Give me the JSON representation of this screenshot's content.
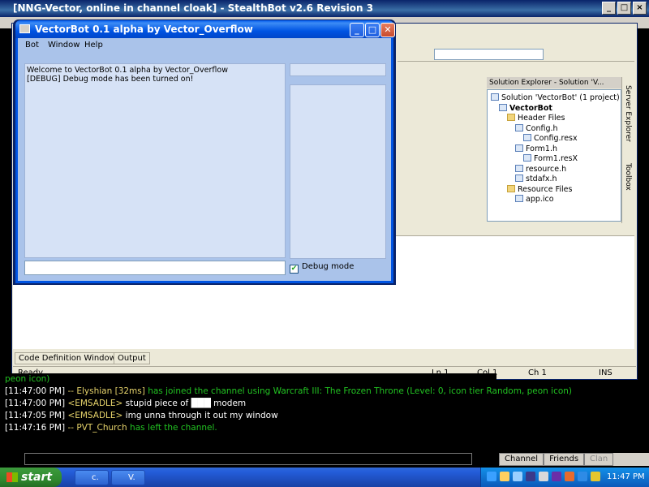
{
  "stealthbot": {
    "title": "[NNG-Vector, online in channel cloak] - StealthBot v2.6 Revision 3",
    "chat": [
      {
        "time": "[11:47:00 PM]",
        "prefix": "-- ",
        "user": "Elyshian [32ms]",
        "text": " has joined the channel using Warcraft III: The Frozen Throne (Level: 0, icon tier Random, peon icon)"
      },
      {
        "time": "[11:47:00 PM]",
        "user": "<EMSADLE>",
        "text": " stupid piece of ███ modem"
      },
      {
        "time": "[11:47:05 PM]",
        "user": "<EMSADLE>",
        "text": " img unna through it out my window"
      },
      {
        "time": "[11:47:16 PM]",
        "prefix": "-- ",
        "user": "PVT_Church",
        "text": " has left the channel."
      }
    ],
    "chat_top_snippet": "peon icon)",
    "tabs": [
      "Channel",
      "Friends",
      "Clan"
    ]
  },
  "vectorbot": {
    "title": "VectorBot 0.1 alpha by Vector_Overflow",
    "menu": [
      "Bot",
      "Window",
      "Help"
    ],
    "log": [
      "Welcome to VectorBot 0.1 alpha by Vector_Overflow",
      "[DEBUG] Debug mode has been turned on!"
    ],
    "debug_label": "Debug mode",
    "debug_checked": true
  },
  "visual_studio": {
    "solution_explorer_title": "Solution Explorer - Solution 'V...",
    "tree": [
      {
        "label": "Solution 'VectorBot' (1 project)",
        "level": 0,
        "kind": "solution"
      },
      {
        "label": "VectorBot",
        "level": 1,
        "kind": "project"
      },
      {
        "label": "Header Files",
        "level": 2,
        "kind": "folder"
      },
      {
        "label": "Config.h",
        "level": 3,
        "kind": "file"
      },
      {
        "label": "Config.resx",
        "level": 4,
        "kind": "file"
      },
      {
        "label": "Form1.h",
        "level": 3,
        "kind": "file"
      },
      {
        "label": "Form1.resX",
        "level": 4,
        "kind": "file"
      },
      {
        "label": "resource.h",
        "level": 3,
        "kind": "file"
      },
      {
        "label": "stdafx.h",
        "level": 3,
        "kind": "file"
      },
      {
        "label": "Resource Files",
        "level": 2,
        "kind": "folder"
      },
      {
        "label": "app.ico",
        "level": 3,
        "kind": "file"
      }
    ],
    "side_tabs": [
      "Server Explorer",
      "Toolbox"
    ],
    "bottom_tabs": [
      "Code Definition Window",
      "Output"
    ],
    "status": {
      "ready": "Ready",
      "ln": "Ln 1",
      "col": "Col 1",
      "ch": "Ch 1",
      "ins": "INS"
    }
  },
  "taskbar": {
    "start_label": "start",
    "tasks": [
      "c.",
      "V."
    ],
    "clock": "11:47 PM"
  }
}
